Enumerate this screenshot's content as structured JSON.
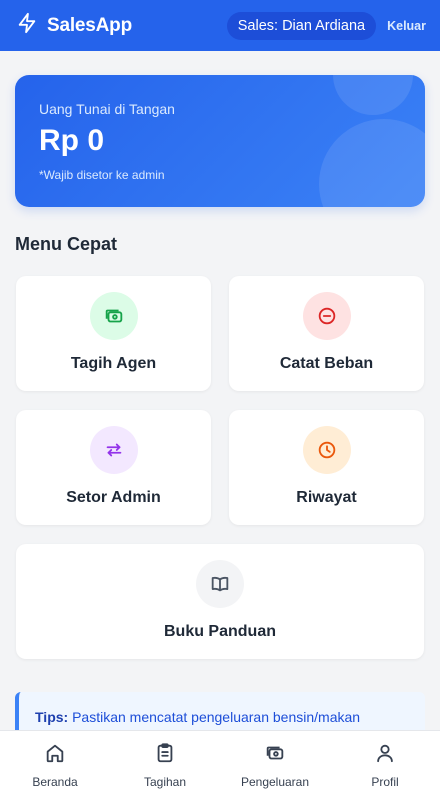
{
  "header": {
    "app_title": "SalesApp",
    "logo_icon": "bolt-icon",
    "sales_user": "Sales: Dian Ardiana",
    "logout_label": "Keluar"
  },
  "cash_card": {
    "label": "Uang Tunai di Tangan",
    "value": "Rp 0",
    "note": "*Wajib disetor ke admin"
  },
  "quick_menu": {
    "title": "Menu Cepat",
    "items": [
      {
        "label": "Tagih Agen",
        "icon": "money-icon",
        "icon_color": "#16a34a",
        "bg_color": "#dcfce7"
      },
      {
        "label": "Catat Beban",
        "icon": "minus-circle-icon",
        "icon_color": "#dc2626",
        "bg_color": "#fee2e2"
      },
      {
        "label": "Setor Admin",
        "icon": "transfer-icon",
        "icon_color": "#9333ea",
        "bg_color": "#f3e8ff"
      },
      {
        "label": "Riwayat",
        "icon": "clock-icon",
        "icon_color": "#ea580c",
        "bg_color": "#ffedd5"
      },
      {
        "label": "Buku Panduan",
        "icon": "book-icon",
        "icon_color": "#4b5563",
        "bg_color": "#f3f4f6"
      }
    ]
  },
  "tips": {
    "title": "Tips:",
    "text": "Pastikan mencatat pengeluaran bensin/makan"
  },
  "bottom_nav": {
    "items": [
      {
        "label": "Beranda",
        "icon": "home-icon"
      },
      {
        "label": "Tagihan",
        "icon": "clipboard-icon"
      },
      {
        "label": "Pengeluaran",
        "icon": "money-icon"
      },
      {
        "label": "Profil",
        "icon": "user-icon"
      }
    ]
  },
  "colors": {
    "primary": "#2563eb",
    "background": "#f3f4f6"
  }
}
